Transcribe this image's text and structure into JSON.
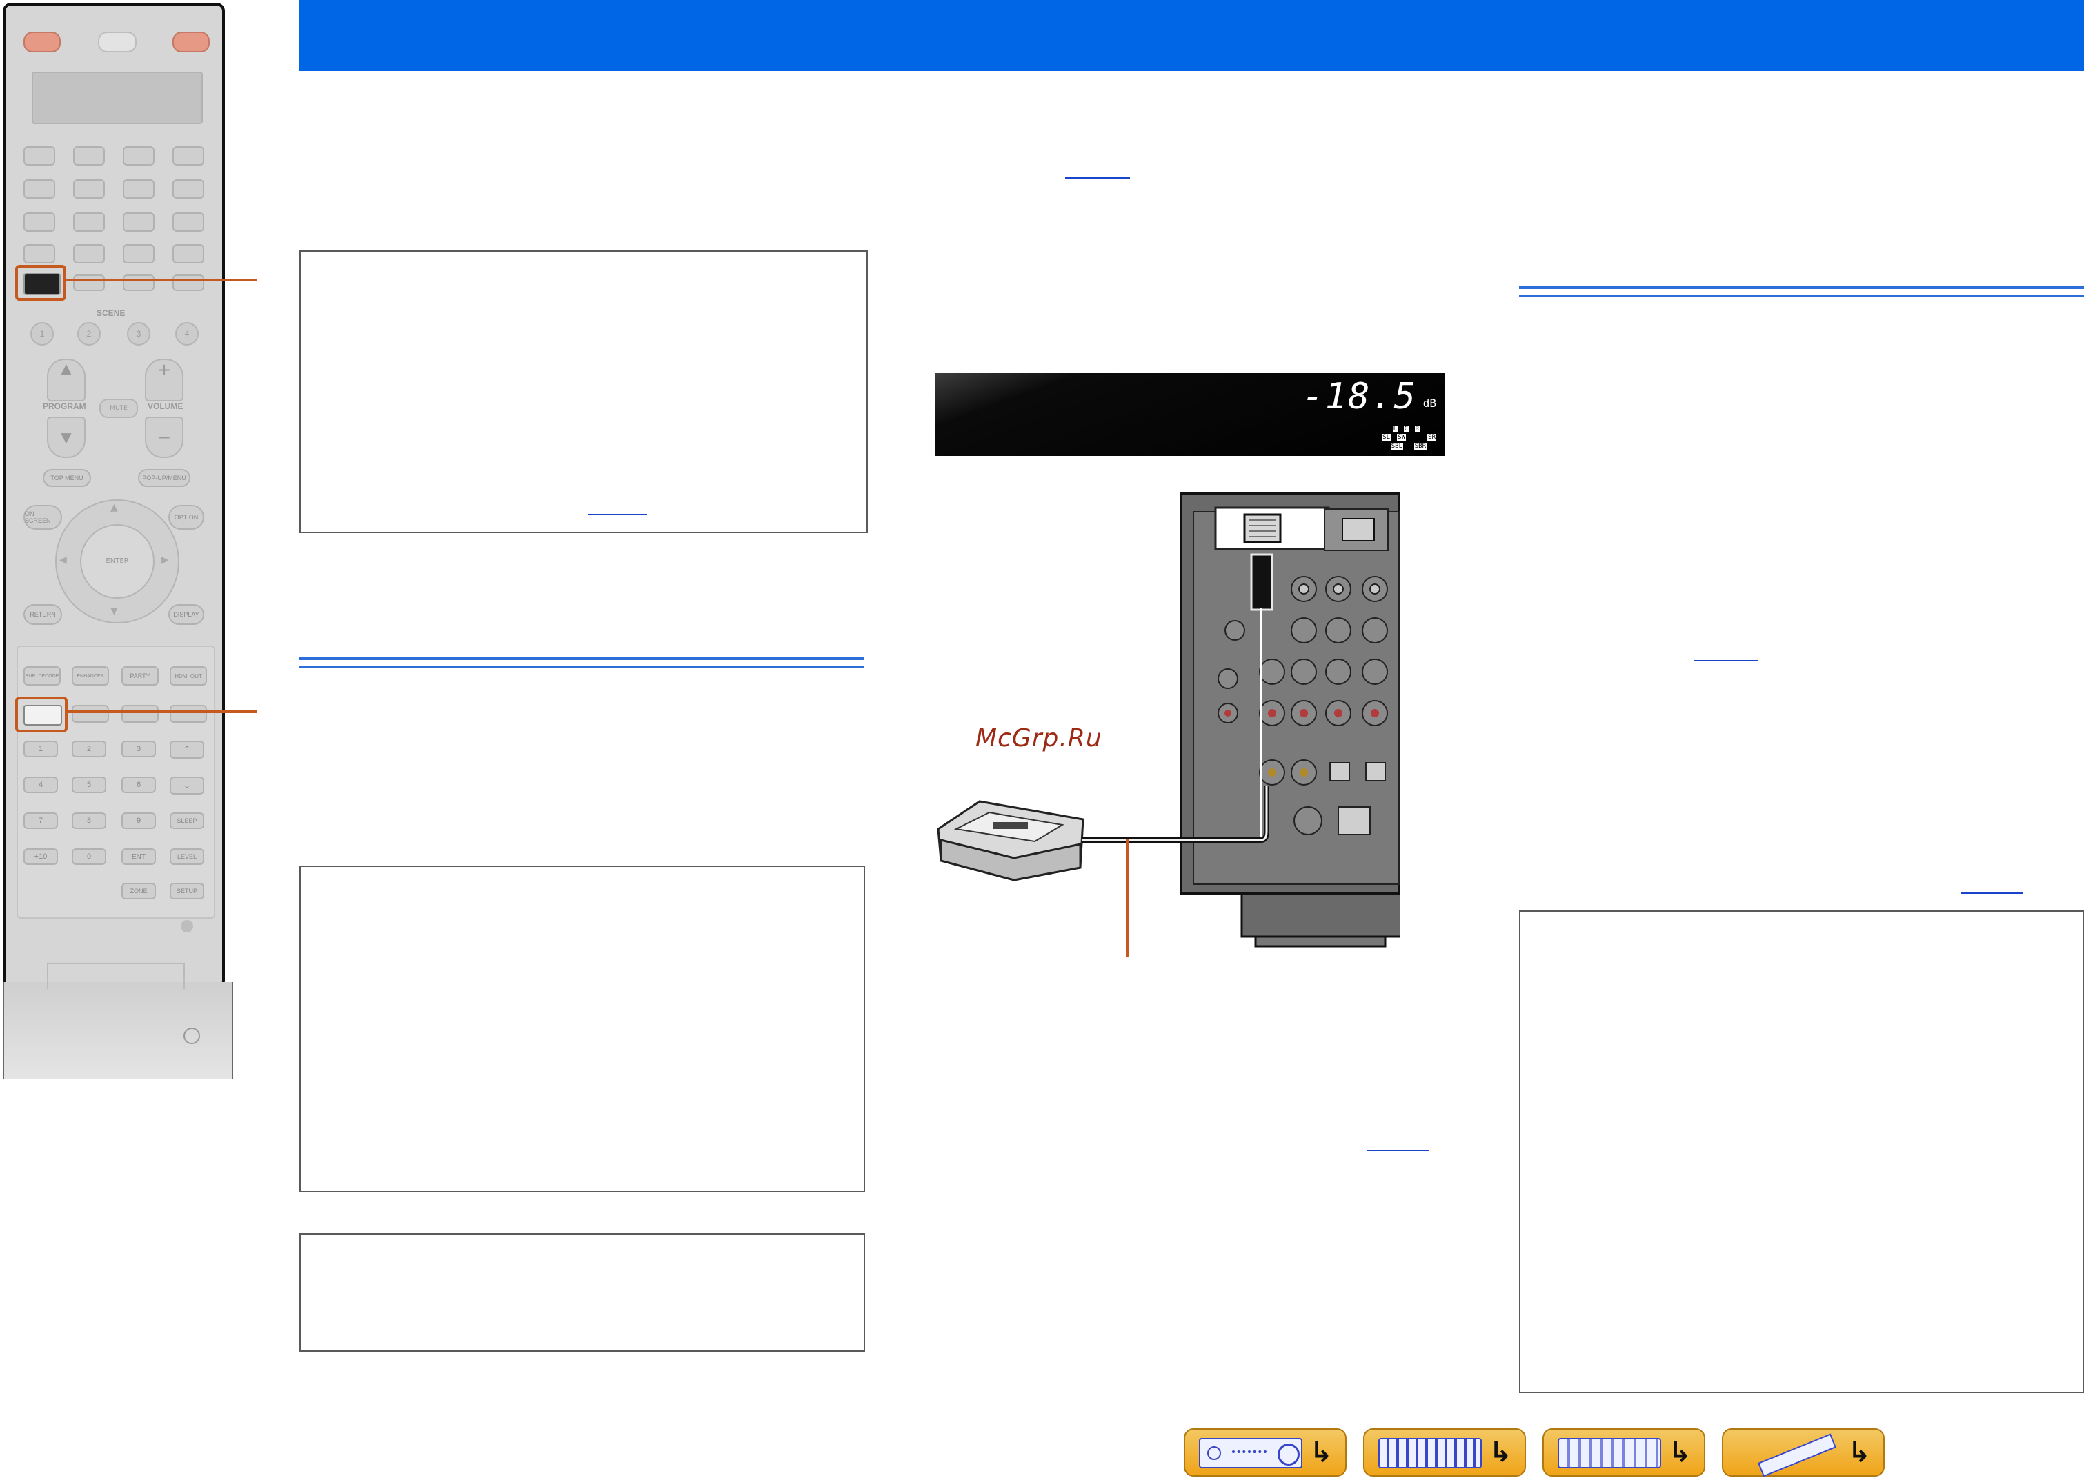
{
  "header": {
    "background": "#0066e6"
  },
  "accent_colors": {
    "rule": "#2d6fd8",
    "callout": "#c65a1e",
    "link": "#1a44c9"
  },
  "remote": {
    "scene_label": "SCENE",
    "scene_buttons": [
      "1",
      "2",
      "3",
      "4"
    ],
    "program_label": "PROGRAM",
    "mute_label": "MUTE",
    "volume_label": "VOLUME",
    "top_menu": "TOP MENU",
    "popup_menu": "POP-UP/MENU",
    "on_screen": "ON SCREEN",
    "option": "OPTION",
    "enter": "ENTER",
    "return": "RETURN",
    "display": "DISPLAY",
    "function_keys": [
      "SUR. DECODE",
      "ENHANCER",
      "PARTY",
      "HDMI OUT"
    ],
    "numeric_keys": [
      "1",
      "2",
      "3",
      "4",
      "5",
      "6",
      "7",
      "8",
      "9",
      "+10",
      "0",
      "ENT"
    ],
    "right_keys": [
      "SLEEP",
      "LEVEL",
      "SETUP"
    ],
    "zone": "ZONE"
  },
  "front_display": {
    "level": "-18.5",
    "unit": "dB",
    "channels": [
      "L",
      "C",
      "R",
      "SL",
      "SW",
      "SR",
      "SBL",
      "SBR"
    ]
  },
  "watermark": "McGrp.Ru",
  "footer_nav": [
    {
      "icon": "receiver-front-icon"
    },
    {
      "icon": "receiver-rear-icon"
    },
    {
      "icon": "front-display-icon"
    },
    {
      "icon": "remote-control-icon"
    }
  ],
  "nav_arrow": "↳"
}
